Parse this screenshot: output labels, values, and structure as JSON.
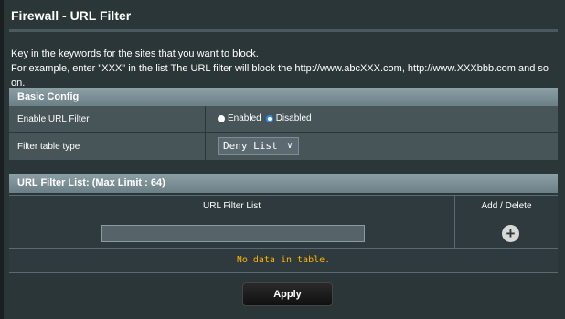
{
  "page": {
    "title": "Firewall - URL Filter",
    "desc_line1": "Key in the keywords for the sites that you want to block.",
    "desc_line2": "For example, enter \"XXX\" in the list The URL filter will block the http://www.abcXXX.com, http://www.XXXbbb.com and so on."
  },
  "basic_config": {
    "heading": "Basic Config",
    "enable_label": "Enable URL Filter",
    "enabled_option": "Enabled",
    "disabled_option": "Disabled",
    "selected": "Disabled",
    "filter_type_label": "Filter table type",
    "filter_type_value": "Deny List"
  },
  "filter_list": {
    "heading": "URL Filter List: (Max Limit : 64)",
    "col_url": "URL Filter List",
    "col_action": "Add / Delete",
    "input_value": "",
    "empty_message": "No data in table."
  },
  "actions": {
    "apply_label": "Apply"
  },
  "colors": {
    "accent_radio": "#2a8dff",
    "empty_message": "#ffb300"
  }
}
